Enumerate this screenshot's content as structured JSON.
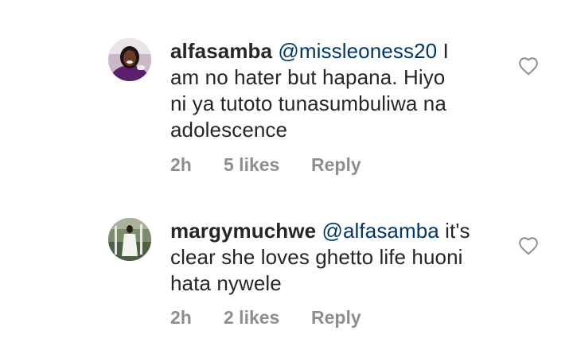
{
  "comments": [
    {
      "username": "alfasamba",
      "mention": "@missleoness20",
      "text_line1_rest": " I",
      "text_line2": "am no hater but hapana. Hiyo",
      "text_line3": "ni ya tutoto tunasumbuliwa na",
      "text_line4": "adolescence",
      "time": "2h",
      "likes": "5 likes",
      "reply": "Reply",
      "like_icon": "heart-outline-icon"
    },
    {
      "username": "margymuchwe",
      "mention": "@alfasamba",
      "text_line1_rest": " it's",
      "text_line2": "clear she loves ghetto life huoni",
      "text_line3": "hata nywele",
      "time": "2h",
      "likes": "2 likes",
      "reply": "Reply",
      "like_icon": "heart-outline-icon"
    }
  ],
  "colors": {
    "text": "#262626",
    "mention": "#00376b",
    "meta": "#8e8e8e",
    "background": "#ffffff"
  }
}
